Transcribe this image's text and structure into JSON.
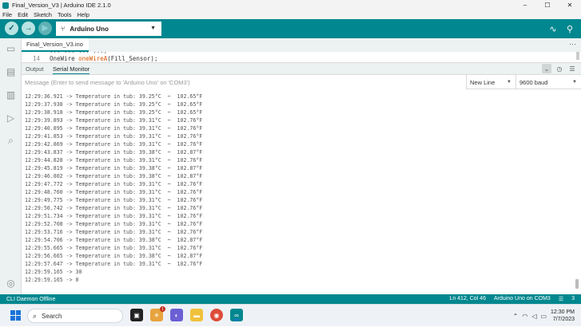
{
  "window": {
    "title": "Final_Version_V3 | Arduino IDE 2.1.0",
    "controls": [
      "–",
      "☐",
      "✕"
    ]
  },
  "menu": [
    "File",
    "Edit",
    "Sketch",
    "Tools",
    "Help"
  ],
  "toolbar": {
    "board": "Arduino Uno",
    "icons": [
      "verify-icon",
      "upload-icon",
      "debug-icon",
      "serial-plotter-icon",
      "serial-monitor-icon"
    ]
  },
  "editor": {
    "tab": "Final_Version_V3.ino",
    "line_number": "14",
    "code_prefix": "OneWire ",
    "code_fn": "oneWireA",
    "code_suffix": "(Fill_Sensor);",
    "peek": "...  ...  ...  ...)"
  },
  "panel": {
    "output_tab": "Output",
    "monitor_tab": "Serial Monitor",
    "message_placeholder": "Message (Enter to send message to 'Arduino Uno' on 'COM3')",
    "line_ending": "New Line",
    "baud": "9600 baud"
  },
  "monitor_lines": [
    "12:29:36.921 -> Temperature in tub: 39.25°C  ~  102.65°F",
    "12:29:37.938 -> Temperature in tub: 39.25°C  ~  102.65°F",
    "12:29:38.918 -> Temperature in tub: 39.25°C  ~  102.65°F",
    "12:29:39.893 -> Temperature in tub: 39.31°C  ~  102.76°F",
    "12:29:40.895 -> Temperature in tub: 39.31°C  ~  102.76°F",
    "12:29:41.853 -> Temperature in tub: 39.31°C  ~  102.76°F",
    "12:29:42.869 -> Temperature in tub: 39.31°C  ~  102.76°F",
    "12:29:43.837 -> Temperature in tub: 39.38°C  ~  102.87°F",
    "12:29:44.828 -> Temperature in tub: 39.31°C  ~  102.76°F",
    "12:29:45.819 -> Temperature in tub: 39.38°C  ~  102.87°F",
    "12:29:46.802 -> Temperature in tub: 39.38°C  ~  102.87°F",
    "12:29:47.772 -> Temperature in tub: 39.31°C  ~  102.76°F",
    "12:29:48.760 -> Temperature in tub: 39.31°C  ~  102.76°F",
    "12:29:49.775 -> Temperature in tub: 39.31°C  ~  102.76°F",
    "12:29:50.742 -> Temperature in tub: 39.31°C  ~  102.76°F",
    "12:29:51.734 -> Temperature in tub: 39.31°C  ~  102.76°F",
    "12:29:52.708 -> Temperature in tub: 39.31°C  ~  102.76°F",
    "12:29:53.716 -> Temperature in tub: 39.31°C  ~  102.76°F",
    "12:29:54.706 -> Temperature in tub: 39.38°C  ~  102.87°F",
    "12:29:55.665 -> Temperature in tub: 39.31°C  ~  102.76°F",
    "12:29:56.665 -> Temperature in tub: 39.38°C  ~  102.87°F",
    "12:29:57.647 -> Temperature in tub: 39.31°C  ~  102.76°F",
    "12:29:59.165 -> 30",
    "12:29:59.165 -> 0"
  ],
  "status": {
    "left": "CLI Daemon Offline",
    "position": "Ln 412, Col 46",
    "board_port": "Arduino Uno on COM3",
    "notifications": "3"
  },
  "taskbar": {
    "search": "Search",
    "time": "12:30 PM",
    "date": "7/7/2023",
    "badge": "1"
  },
  "colors": {
    "accent": "#00878f",
    "sidebar": "#ecf1f1"
  }
}
